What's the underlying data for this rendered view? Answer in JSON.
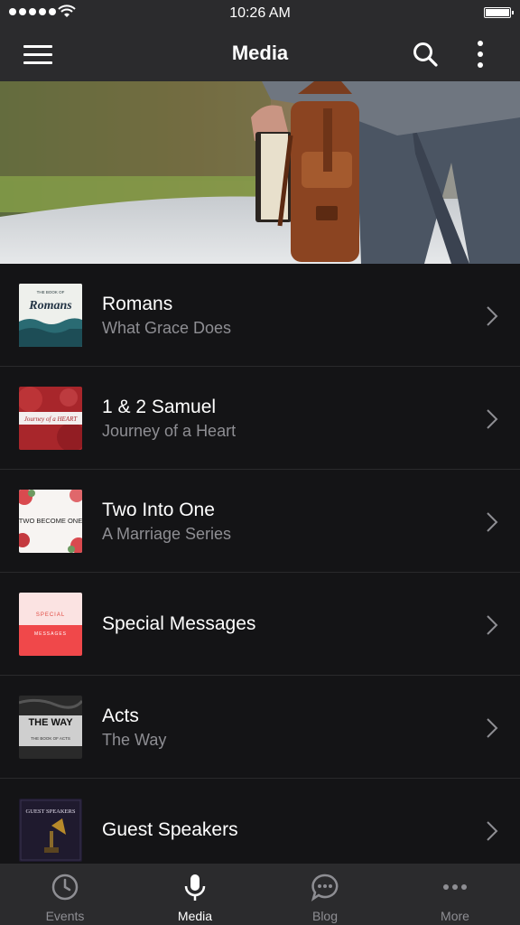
{
  "status_bar": {
    "time": "10:26 AM"
  },
  "header": {
    "title": "Media"
  },
  "series": [
    {
      "title": "Romans",
      "subtitle": "What Grace Does",
      "thumb_text": "Romans",
      "thumb_small": "THE BOOK OF"
    },
    {
      "title": "1 & 2 Samuel",
      "subtitle": "Journey of a Heart",
      "thumb_text": "Journey of a HEART"
    },
    {
      "title": "Two Into One",
      "subtitle": "A Marriage Series",
      "thumb_text": "TWO BECOME ONE"
    },
    {
      "title": "Special Messages",
      "subtitle": "",
      "thumb_text": "SPECIAL",
      "thumb_text2": "MESSAGES"
    },
    {
      "title": "Acts",
      "subtitle": "The Way",
      "thumb_text": "THE WAY",
      "thumb_small": "THE BOOK OF ACTS"
    },
    {
      "title": "Guest Speakers",
      "subtitle": "",
      "thumb_text": "GUEST SPEAKERS"
    }
  ],
  "tabs": [
    {
      "label": "Events",
      "icon": "clock-icon"
    },
    {
      "label": "Media",
      "icon": "microphone-icon",
      "active": true
    },
    {
      "label": "Blog",
      "icon": "chat-bubble-icon"
    },
    {
      "label": "More",
      "icon": "more-dots-icon"
    }
  ],
  "colors": {
    "background": "#141416",
    "bar": "#2b2b2d",
    "subtitle": "#8e8e93",
    "accent_red": "#f0484a"
  }
}
